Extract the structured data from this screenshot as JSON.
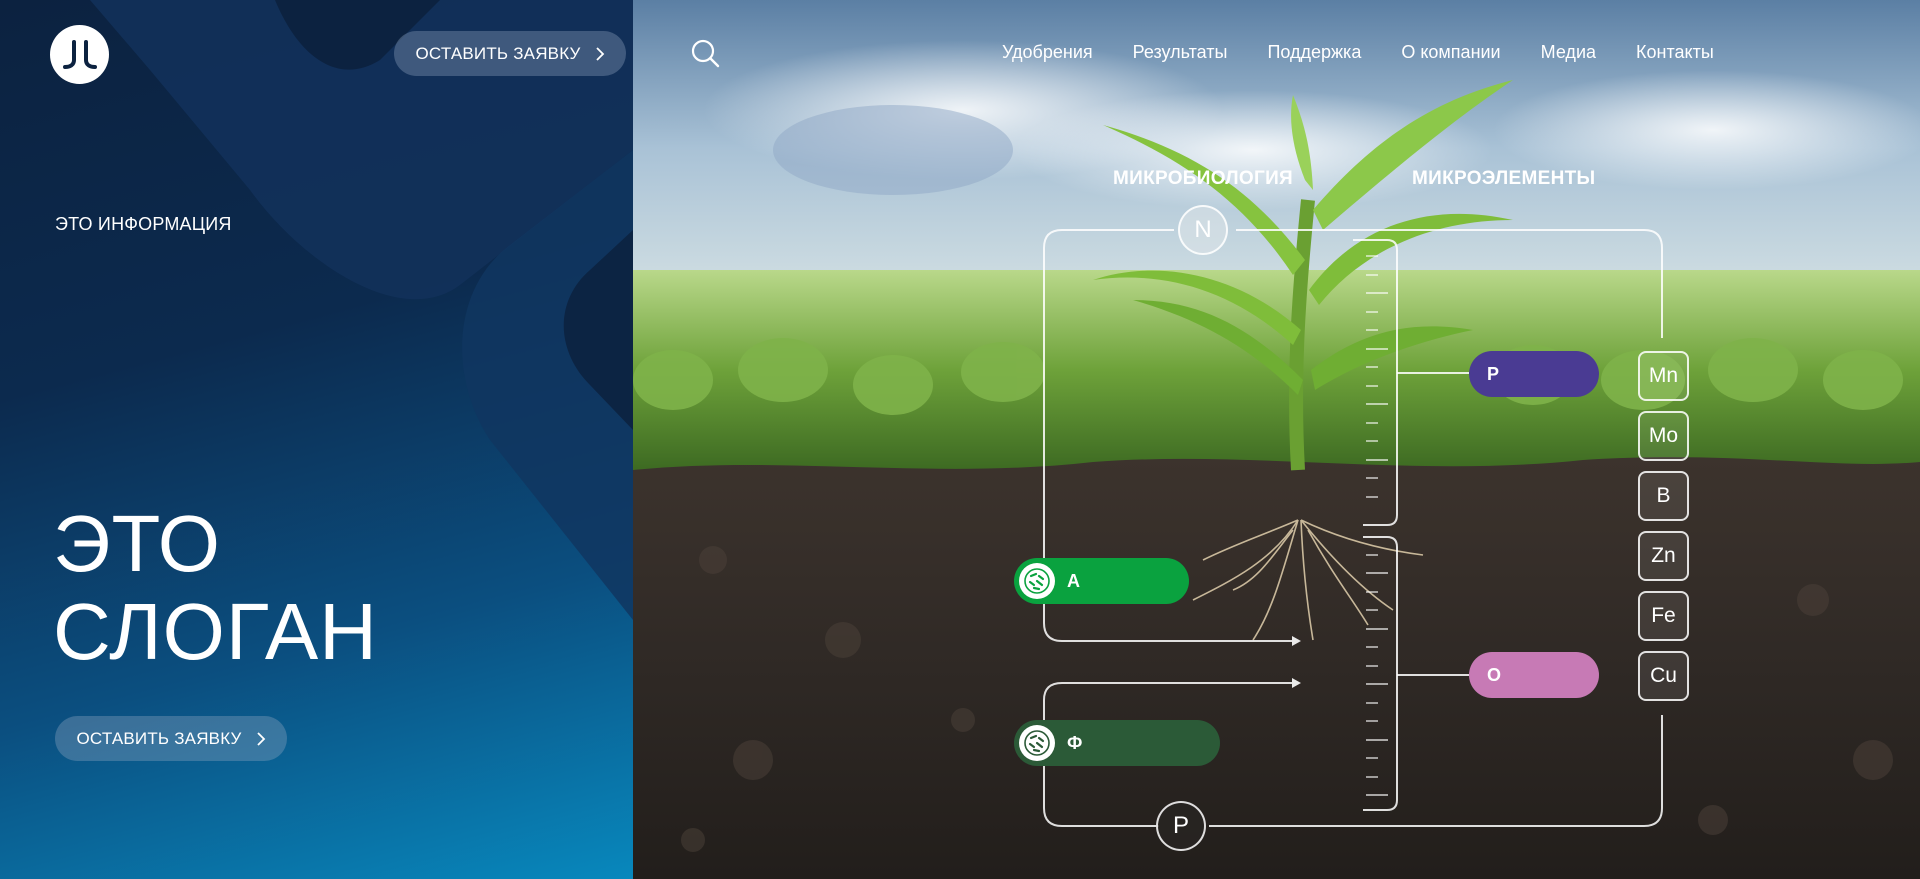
{
  "brand": {
    "logo_alt": "company-logo"
  },
  "left": {
    "cta_top": "ОСТАВИТЬ ЗАЯВКУ",
    "info_label": "ЭТО ИНФОРМАЦИЯ",
    "slogan_line1": "ЭТО",
    "slogan_line2": "СЛОГАН",
    "cta_bottom": "ОСТАВИТЬ ЗАЯВКУ"
  },
  "nav": {
    "items": [
      {
        "label": "Удобрения"
      },
      {
        "label": "Результаты"
      },
      {
        "label": "Поддержка"
      },
      {
        "label": "О компании"
      },
      {
        "label": "Медиа"
      },
      {
        "label": "Контакты"
      }
    ]
  },
  "diagram": {
    "label_microbiology": "МИКРОБИОЛОГИЯ",
    "label_microelements": "МИКРОЭЛЕМЕНТЫ",
    "node_top": "N",
    "node_bottom": "P",
    "pill_p": "P",
    "pill_o": "O",
    "pill_a": "А",
    "pill_f": "Ф",
    "elements": [
      "Mn",
      "Mo",
      "B",
      "Zn",
      "Fe",
      "Cu"
    ]
  },
  "colors": {
    "purple": "#4a3b93",
    "pink": "#c77ab5",
    "green_bright": "#0aa23f",
    "green_dark": "#2b5a37",
    "panel_dark": "#0c2240",
    "panel_light": "#0888bd"
  }
}
